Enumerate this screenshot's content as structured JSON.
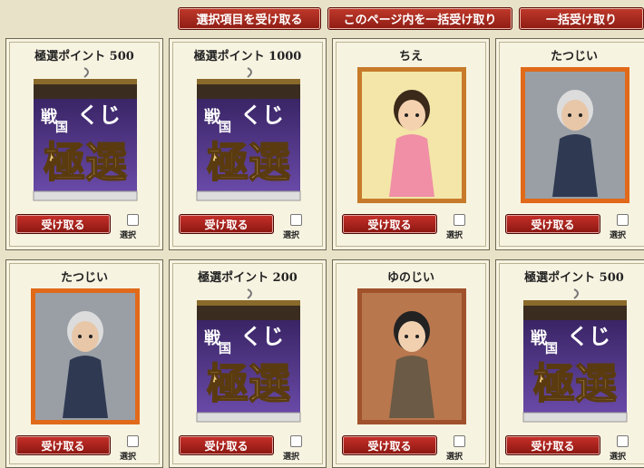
{
  "toolbar": {
    "receive_selected": "選択項目を受け取る",
    "receive_page": "このページ内を一括受け取り",
    "receive_all": "一括受け取り"
  },
  "cards": [
    {
      "title": "極選ポイント 500",
      "type": "ticket",
      "button": "受け取る",
      "select_label": "選択"
    },
    {
      "title": "極選ポイント 1000",
      "type": "ticket",
      "button": "受け取る",
      "select_label": "選択"
    },
    {
      "title": "ちえ",
      "type": "character",
      "button": "受け取る",
      "select_label": "選択"
    },
    {
      "title": "たつじい",
      "type": "character",
      "button": "受け取る",
      "select_label": "選択"
    },
    {
      "title": "たつじい",
      "type": "character",
      "button": "受け取る",
      "select_label": "選択"
    },
    {
      "title": "極選ポイント 200",
      "type": "ticket",
      "button": "受け取る",
      "select_label": "選択"
    },
    {
      "title": "ゆのじい",
      "type": "character",
      "button": "受け取る",
      "select_label": "選択"
    },
    {
      "title": "極選ポイント 500",
      "type": "ticket",
      "button": "受け取る",
      "select_label": "選択"
    }
  ],
  "ticket_art": {
    "line1": "戦",
    "line2": "国",
    "line3": "くじ",
    "big": "極選"
  },
  "colors": {
    "button_red": "#a8231c",
    "ticket_purple": "#4a2a7a",
    "card_bg": "#f7f3e1"
  }
}
